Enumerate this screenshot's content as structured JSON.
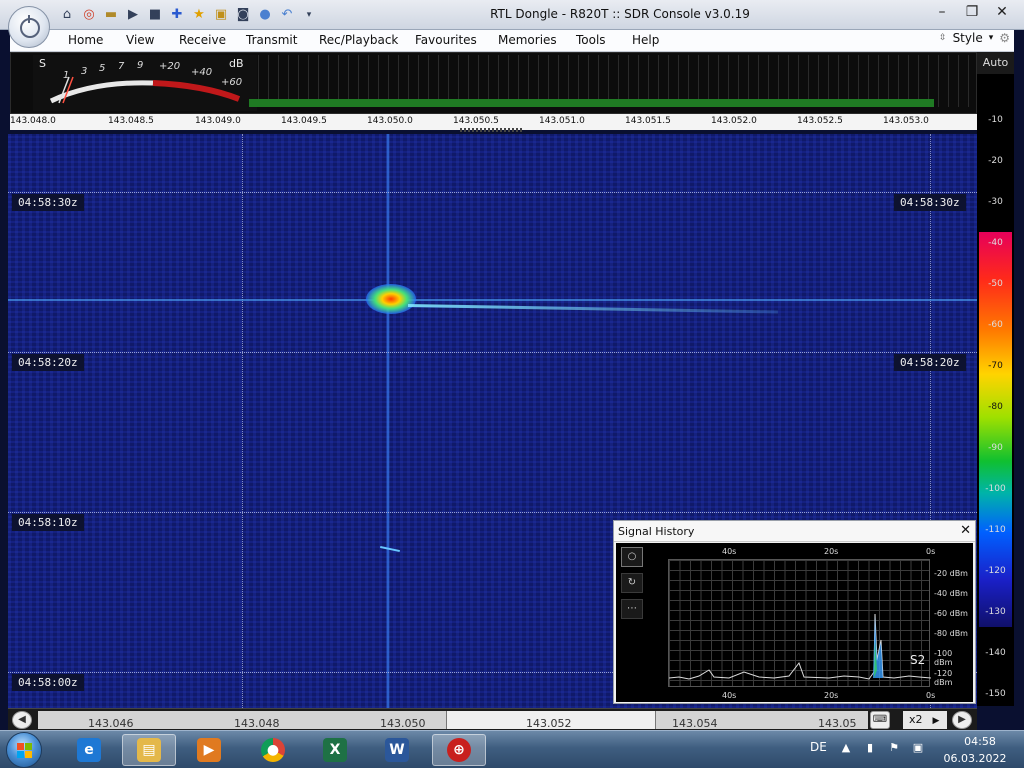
{
  "window": {
    "title": "RTL Dongle - R820T :: SDR Console v3.0.19",
    "controls": [
      "minimize-icon",
      "restore-icon",
      "close-icon"
    ]
  },
  "quick_access": [
    "home-icon",
    "lifebuoy-icon",
    "folder-icon",
    "play-icon",
    "stop-icon",
    "add-icon",
    "star-icon",
    "lock-icon",
    "camera-icon",
    "drop-icon",
    "undo-icon",
    "dropdown-icon"
  ],
  "menu": {
    "items": [
      "Home",
      "View",
      "Receive",
      "Transmit",
      "Rec/Playback",
      "Favourites",
      "Memories",
      "Tools",
      "Help"
    ],
    "style_label": "Style"
  },
  "smeter": {
    "s_label": "S",
    "scale": [
      "1",
      "3",
      "5",
      "7",
      "9"
    ],
    "plus_scale": [
      "+20",
      "+40",
      "+60"
    ],
    "db_label": "dB"
  },
  "frequency_scale": [
    "143.048.0",
    "143.048.5",
    "143.049.0",
    "143.049.5",
    "143.050.0",
    "143.050.5",
    "143.051.0",
    "143.051.5",
    "143.052.0",
    "143.052.5",
    "143.053.0"
  ],
  "waterfall": {
    "time_labels": [
      "04:58:30z",
      "04:58:20z",
      "04:58:10z",
      "04:58:00z"
    ]
  },
  "level_scale": {
    "mode": "Auto",
    "levels": [
      "-10",
      "-20",
      "-30",
      "-40",
      "-50",
      "-60",
      "-70",
      "-80",
      "-90",
      "-100",
      "-110",
      "-120",
      "-130",
      "-140",
      "-150"
    ],
    "colors": {
      "high": "#e6005a",
      "mid": "#ffd400",
      "low": "#10106a"
    }
  },
  "bottom_nav": {
    "labels": [
      "143.046",
      "143.048",
      "143.050",
      "143.052",
      "143.054",
      "143.05"
    ],
    "zoom": "x2"
  },
  "signal_history": {
    "title": "Signal History",
    "top_axis": [
      "40s",
      "20s",
      "0s"
    ],
    "bottom_axis": [
      "40s",
      "20s",
      "0s"
    ],
    "db_labels": [
      "-20 dBm",
      "-40 dBm",
      "-60 dBm",
      "-80 dBm",
      "-100 dBm",
      "-120 dBm"
    ],
    "s_reading": "S2",
    "tools": [
      "record-icon",
      "refresh-icon",
      "more-icon"
    ]
  },
  "taskbar": {
    "apps": [
      "internet-explorer-icon",
      "file-explorer-icon",
      "media-player-icon",
      "chrome-icon",
      "excel-icon",
      "word-icon",
      "sdr-console-icon"
    ],
    "language": "DE",
    "time": "04:58",
    "date": "06.03.2022"
  }
}
